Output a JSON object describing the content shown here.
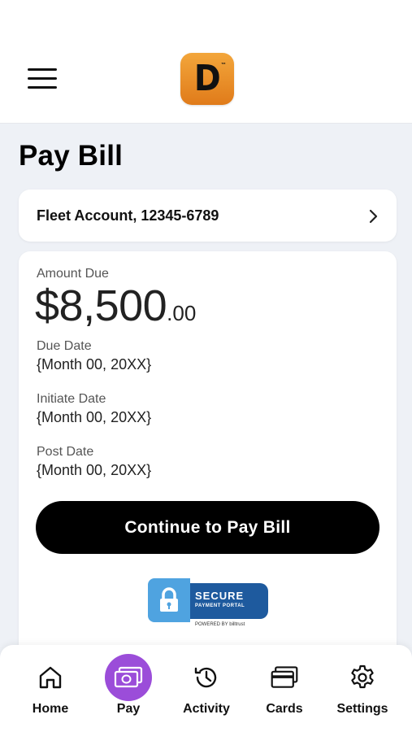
{
  "header": {
    "logo_letter": "D",
    "logo_tm": "™",
    "logo_color": "#e8891f"
  },
  "page": {
    "title": "Pay Bill"
  },
  "account": {
    "label": "Fleet Account, 12345-6789"
  },
  "bill": {
    "amount_label": "Amount Due",
    "amount_main": "$8,500",
    "amount_cents": ".00",
    "due_label": "Due Date",
    "due_value": "{Month 00, 20XX}",
    "initiate_label": "Initiate Date",
    "initiate_value": "{Month 00, 20XX}",
    "post_label": "Post Date",
    "post_value": "{Month 00, 20XX}",
    "pay_button": "Continue to Pay Bill"
  },
  "secure": {
    "title": "SECURE",
    "subtitle": "PAYMENT PORTAL",
    "powered": "POWERED BY billtrust"
  },
  "nav": {
    "active_color": "#9b4dd9",
    "items": [
      {
        "label": "Home",
        "icon": "home-icon"
      },
      {
        "label": "Pay",
        "icon": "money-icon"
      },
      {
        "label": "Activity",
        "icon": "history-icon"
      },
      {
        "label": "Cards",
        "icon": "card-icon"
      },
      {
        "label": "Settings",
        "icon": "gear-icon"
      }
    ]
  }
}
